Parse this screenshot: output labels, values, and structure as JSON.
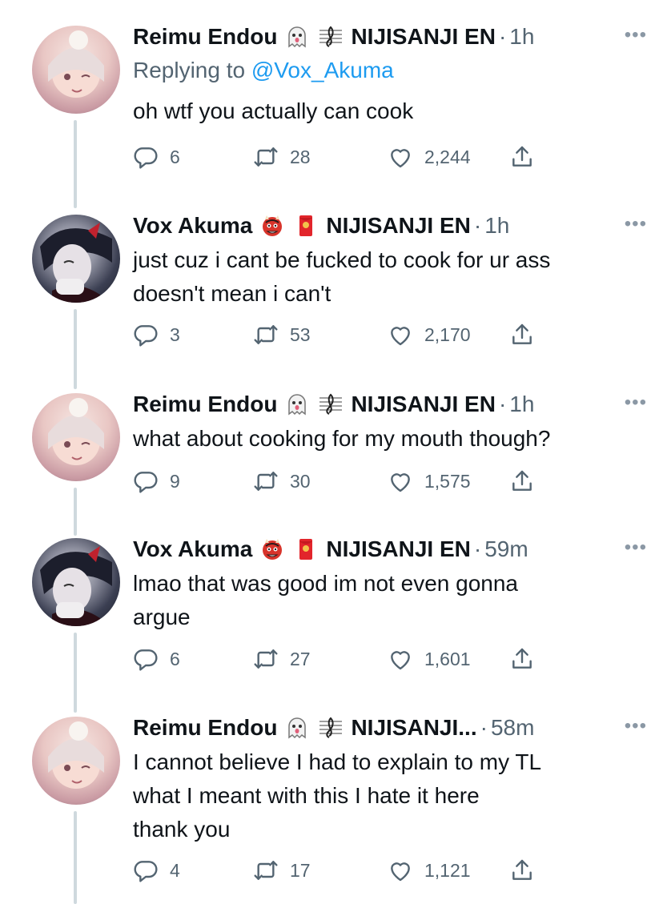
{
  "tweets": [
    {
      "author": "Reimu Endou",
      "avatar": "reimu",
      "emojis": [
        "ghost-emoji",
        "music-score-emoji"
      ],
      "affiliation": "NIJISANJI EN",
      "time": "1h",
      "replying_prefix": "Replying to ",
      "replying_handle": "@Vox_Akuma",
      "lines": [
        "oh wtf you actually can cook"
      ],
      "replies": "6",
      "retweets": "28",
      "likes": "2,244"
    },
    {
      "author": "Vox Akuma",
      "avatar": "vox",
      "emojis": [
        "ogre-emoji",
        "red-envelope-emoji"
      ],
      "affiliation": "NIJISANJI EN",
      "time": "1h",
      "lines": [
        "just cuz i cant be fucked to cook for ur ass",
        "doesn't mean i can't"
      ],
      "replies": "3",
      "retweets": "53",
      "likes": "2,170"
    },
    {
      "author": "Reimu Endou",
      "avatar": "reimu",
      "emojis": [
        "ghost-emoji",
        "music-score-emoji"
      ],
      "affiliation": "NIJISANJI EN",
      "time": "1h",
      "lines": [
        "what about cooking for my mouth though?"
      ],
      "replies": "9",
      "retweets": "30",
      "likes": "1,575"
    },
    {
      "author": "Vox Akuma",
      "avatar": "vox",
      "emojis": [
        "ogre-emoji",
        "red-envelope-emoji"
      ],
      "affiliation": "NIJISANJI EN",
      "time": "59m",
      "lines": [
        "lmao that was good im not even gonna",
        "argue"
      ],
      "replies": "6",
      "retweets": "27",
      "likes": "1,601"
    },
    {
      "author": "Reimu Endou",
      "avatar": "reimu",
      "emojis": [
        "ghost-emoji",
        "music-score-emoji"
      ],
      "affiliation": "NIJISANJI...",
      "time": "58m",
      "lines": [
        "I cannot believe I had to explain to my TL",
        "what I meant with this I hate it here",
        "thank you"
      ],
      "replies": "4",
      "retweets": "17",
      "likes": "1,121"
    }
  ],
  "separator": "·",
  "more_glyph": "•••",
  "colors": {
    "secondary_text": "#536471",
    "link": "#1d9bf0",
    "thread_line": "#cfd9de"
  }
}
